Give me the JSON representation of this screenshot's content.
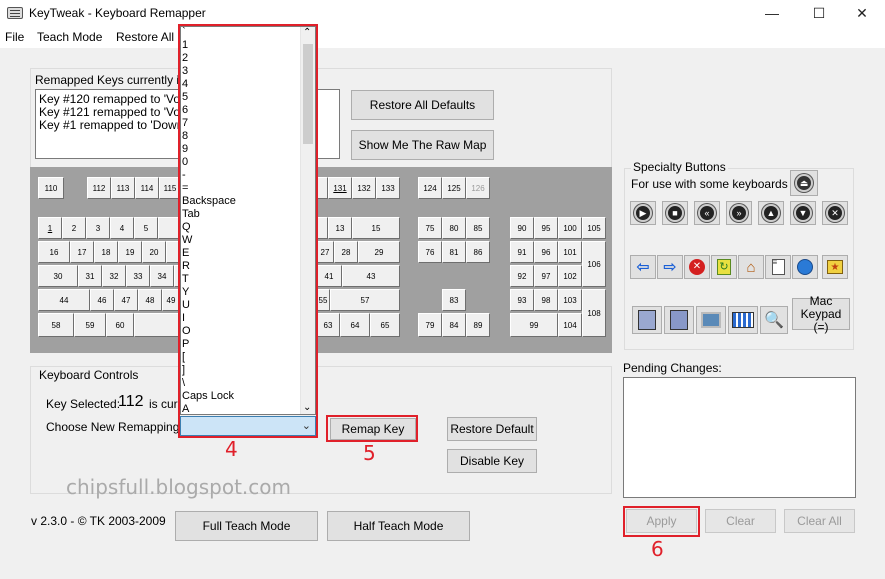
{
  "window": {
    "title": "KeyTweak -  Keyboard Remapper",
    "minimize_glyph": "—",
    "maximize_glyph": "☐",
    "close_glyph": "✕"
  },
  "menu": [
    "File",
    "Teach Mode",
    "Restore All D"
  ],
  "remapped": {
    "label": "Remapped Keys currently in ef",
    "lines": [
      "Key #120 remapped to 'Volun",
      "Key #121 remapped to 'Volun",
      "Key #1 remapped to 'Down A"
    ]
  },
  "buttons": {
    "restore_all_defaults": "Restore All Defaults",
    "show_raw_map": "Show Me The Raw Map",
    "remap_key": "Remap Key",
    "restore_default": "Restore Default",
    "disable_key": "Disable Key",
    "full_teach": "Full Teach Mode",
    "half_teach": "Half Teach Mode",
    "apply": "Apply",
    "clear": "Clear",
    "clear_all": "Clear All"
  },
  "keyboard": {
    "fkeys": [
      "110",
      "112",
      "113",
      "114",
      "115",
      "",
      "",
      "",
      "",
      "",
      "",
      "131",
      "132",
      "133",
      "124",
      "125",
      "126"
    ],
    "row1": [
      "1",
      "2",
      "3",
      "4",
      "5",
      "",
      "",
      "",
      "",
      "",
      "",
      "",
      "13",
      "15"
    ],
    "row2": [
      "16",
      "17",
      "18",
      "19",
      "20",
      "",
      "",
      "",
      "",
      "",
      "",
      "27",
      "28",
      "29"
    ],
    "row3": [
      "30",
      "31",
      "32",
      "33",
      "34",
      "",
      "",
      "",
      "",
      "",
      "41",
      "43"
    ],
    "row4": [
      "44",
      "46",
      "47",
      "48",
      "49",
      "",
      "",
      "",
      "",
      "",
      "55",
      "57"
    ],
    "row5": [
      "58",
      "59",
      "60",
      "",
      "63",
      "64",
      "65"
    ],
    "nav": [
      "75",
      "80",
      "85",
      "76",
      "81",
      "86",
      "83",
      "79",
      "84",
      "89"
    ],
    "num": [
      "90",
      "95",
      "100",
      "105",
      "91",
      "96",
      "101",
      "106",
      "92",
      "97",
      "102",
      "93",
      "98",
      "103",
      "108",
      "99",
      "104"
    ]
  },
  "specialty": {
    "title": "Specialty Buttons",
    "subtitle": "For use with some keyboards",
    "mac_keypad": "Mac\nKeypad (=)"
  },
  "controls": {
    "group_label": "Keyboard Controls",
    "key_selected_label": "Key Selected:",
    "key_selected_value": "112",
    "key_selected_suffix": "is curr",
    "choose_label": "Choose New Remapping"
  },
  "dropdown": {
    "items": [
      "`",
      "1",
      "2",
      "3",
      "4",
      "5",
      "6",
      "7",
      "8",
      "9",
      "0",
      "-",
      "=",
      "Backspace",
      "Tab",
      "Q",
      "W",
      "E",
      "R",
      "T",
      "Y",
      "U",
      "I",
      "O",
      "P",
      "[",
      "]",
      "\\",
      "Caps Lock",
      "A"
    ],
    "selected": ""
  },
  "pending": {
    "label": "Pending Changes:"
  },
  "footer": {
    "version": "v 2.3.0 - © TK 2003-2009"
  },
  "watermark": "chipsfull.blogspot.com",
  "annotations": {
    "dropdown": "4",
    "remap": "5",
    "apply": "6"
  },
  "colors": {
    "annotation": "#e0202a",
    "keyboard_bg": "#a0a0a0"
  }
}
